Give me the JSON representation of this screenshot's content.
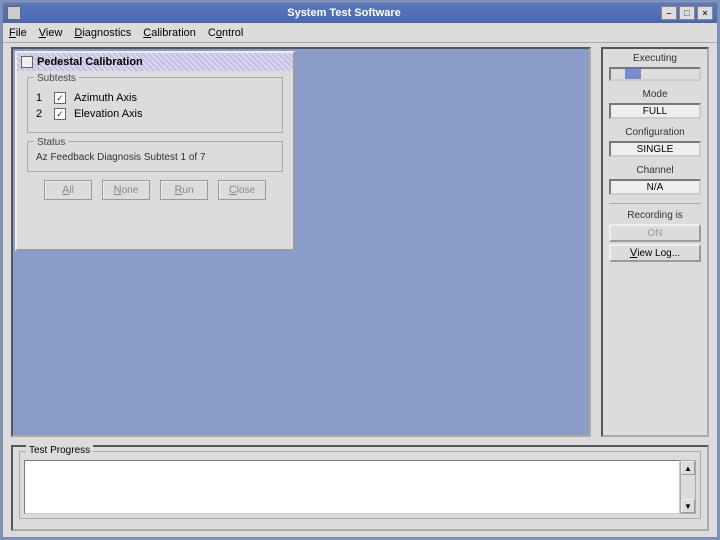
{
  "window": {
    "title": "System Test Software"
  },
  "menu": {
    "file": "File",
    "view": "View",
    "diagnostics": "Diagnostics",
    "calibration": "Calibration",
    "control": "Control"
  },
  "dialog": {
    "title": "Pedestal Calibration",
    "subtests_legend": "Subtests",
    "subtest1_num": "1",
    "subtest1_label": "Azimuth Axis",
    "subtest1_checked": true,
    "subtest2_num": "2",
    "subtest2_label": "Elevation Axis",
    "subtest2_checked": true,
    "status_legend": "Status",
    "status_text": "Az Feedback Diagnosis Subtest 1 of 7",
    "btn_all": "All",
    "btn_none": "None",
    "btn_run": "Run",
    "btn_close": "Close"
  },
  "sidebar": {
    "executing": "Executing",
    "mode_label": "Mode",
    "mode_value": "FULL",
    "config_label": "Configuration",
    "config_value": "SINGLE",
    "channel_label": "Channel",
    "channel_value": "N/A",
    "recording_label": "Recording is",
    "recording_value": "ON",
    "viewlog": "View Log..."
  },
  "progress": {
    "legend": "Test Progress"
  }
}
